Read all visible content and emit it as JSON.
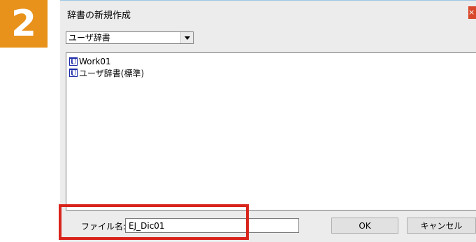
{
  "step": {
    "number": "2",
    "color": "#e8911b"
  },
  "dialog": {
    "title": "辞書の新規作成",
    "close_label": "×",
    "dictionary_select": {
      "selected": "ユーザ辞書"
    },
    "list": {
      "items": [
        {
          "icon": "user-dictionary-icon",
          "label": "Work01"
        },
        {
          "icon": "user-dictionary-icon",
          "label": "ユーザ辞書(標準)"
        }
      ]
    },
    "file_name": {
      "label": "ファイル名:",
      "value": "EJ_Dic01"
    },
    "ok_label": "OK",
    "cancel_label": "キャンセル"
  },
  "highlight_color": "#d9241c"
}
